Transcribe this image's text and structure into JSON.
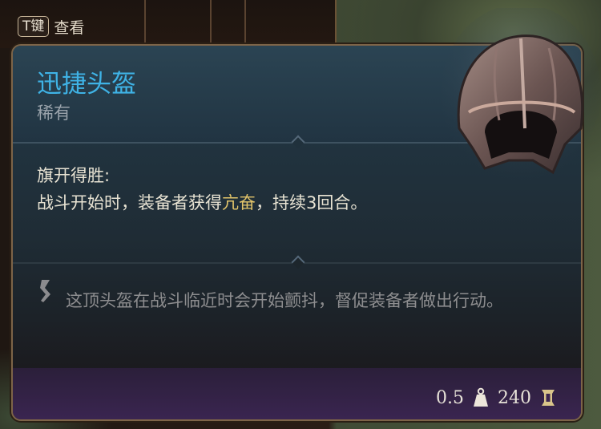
{
  "hint": {
    "key": "T键",
    "label": "查看"
  },
  "item": {
    "name": "迅捷头盔",
    "rarity": "稀有",
    "passive_name": "旗开得胜:",
    "passive_desc_before": "战斗开始时，装备者获得",
    "passive_keyword": "亢奋",
    "passive_desc_after": "，持续3回合。",
    "lore": "这顶头盔在战斗临近时会开始颤抖，督促装备者做出行动。",
    "weight": "0.5",
    "value": "240"
  },
  "colors": {
    "title": "#3fb3e6",
    "keyword": "#e2c46a",
    "rarity": "#9aa3ab",
    "lore": "#8d8d8f"
  },
  "icons": {
    "lore": "lore-icon",
    "weight": "weight-icon",
    "value": "gold-coin-icon"
  }
}
